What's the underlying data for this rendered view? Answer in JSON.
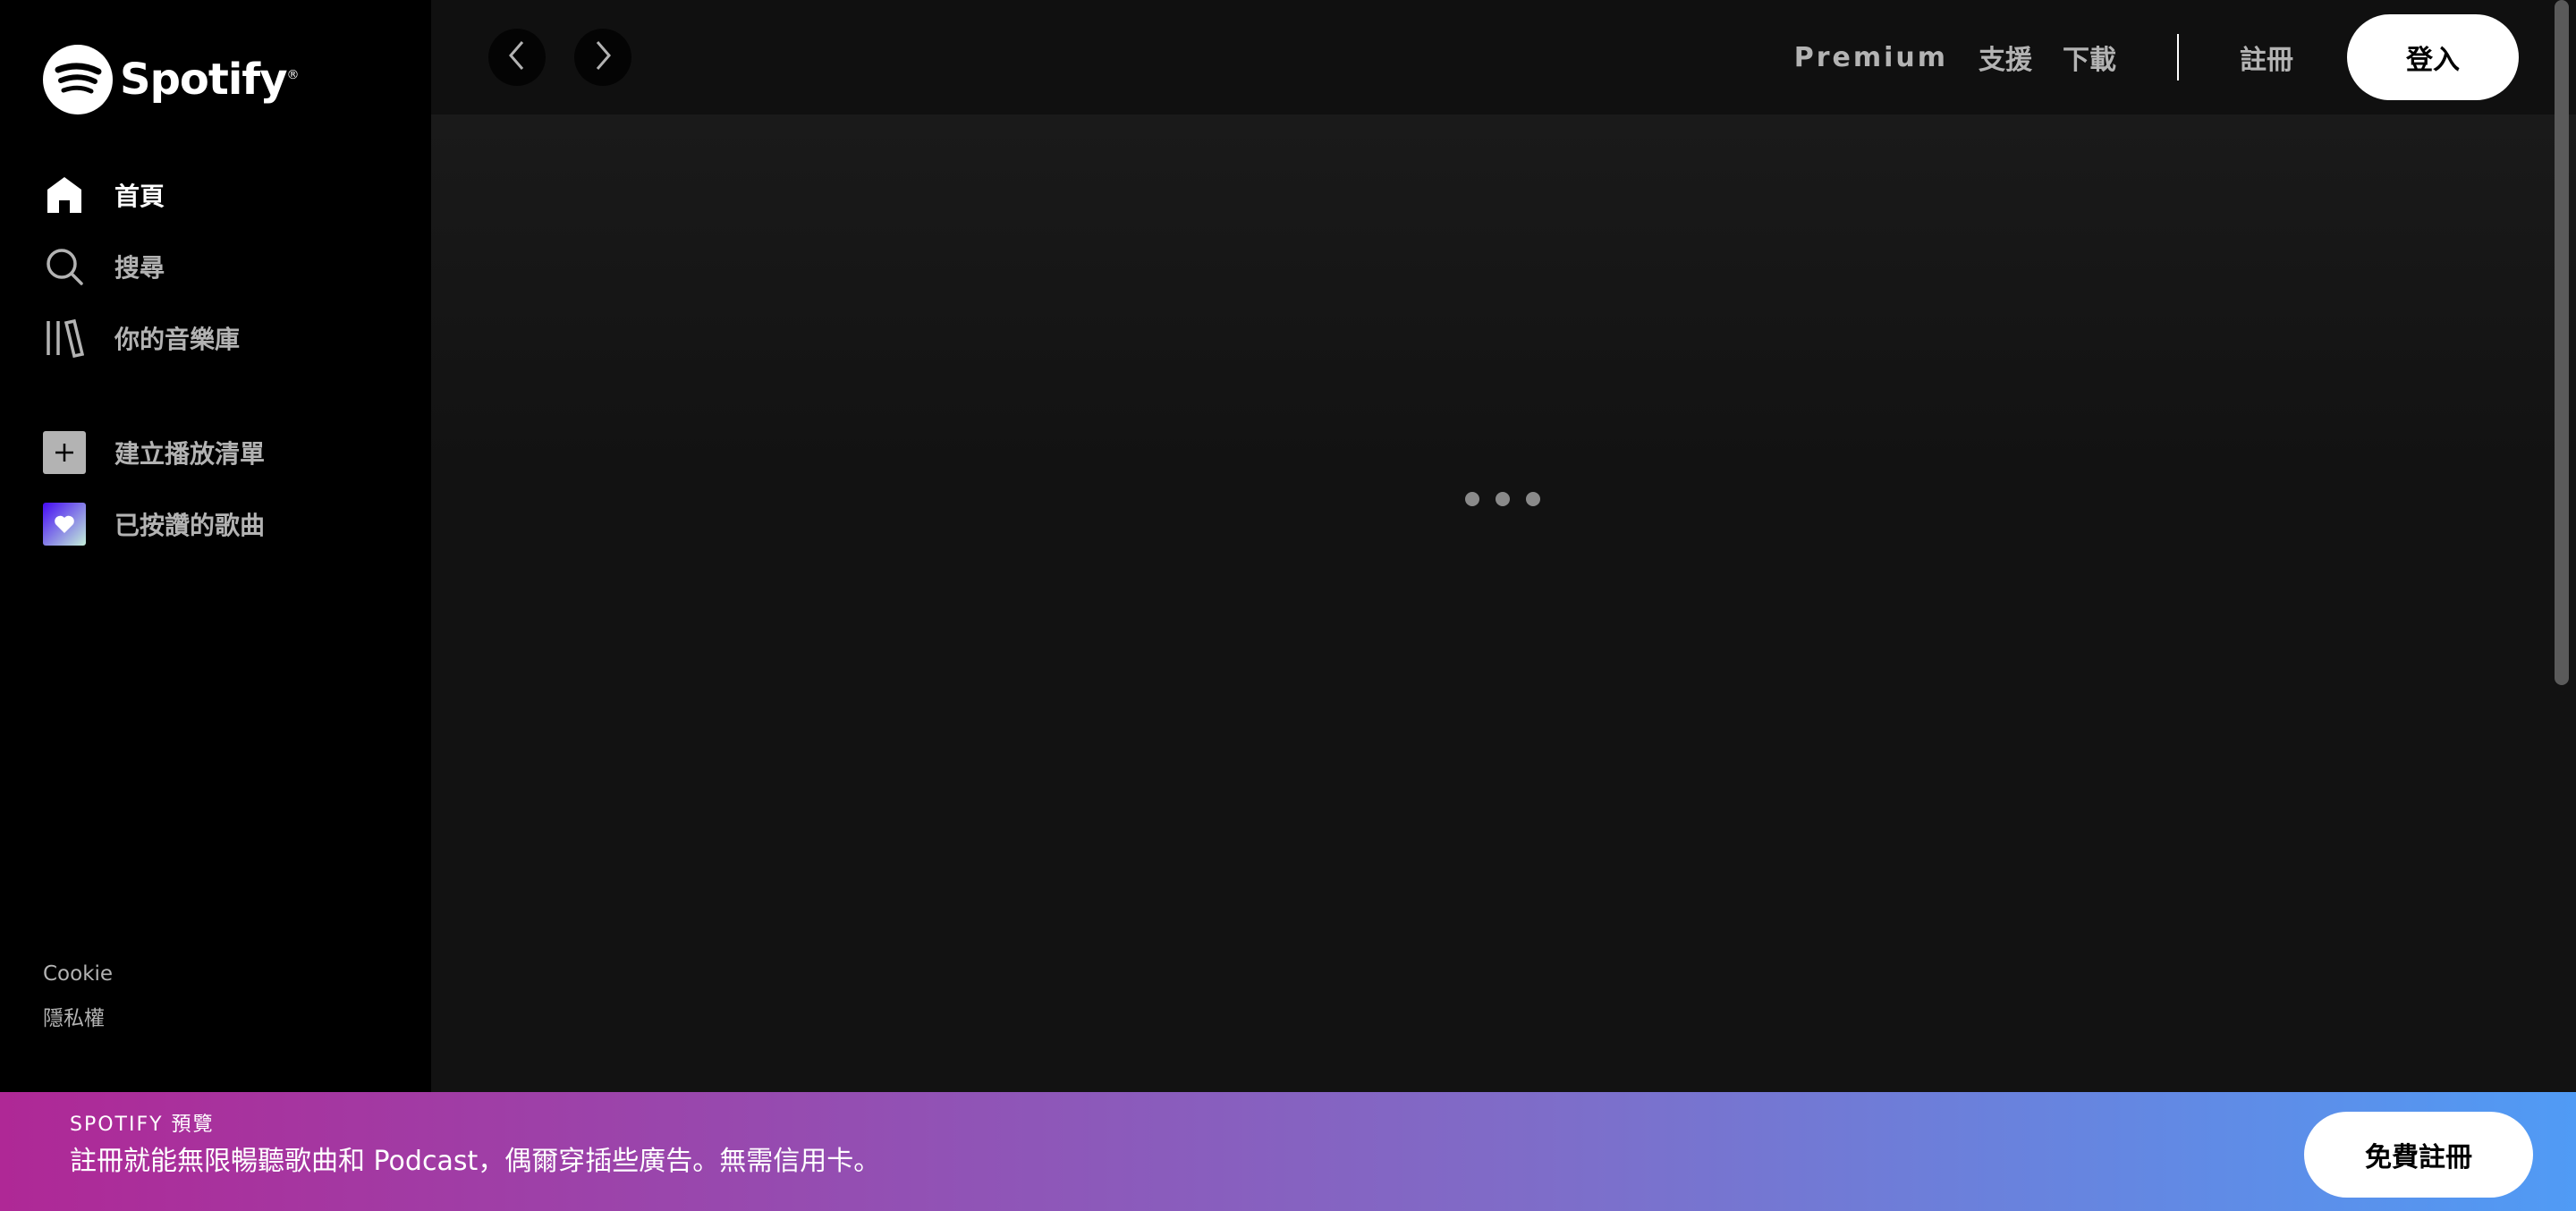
{
  "app": {
    "brand_name": "Spotify",
    "accent_color": "#1db954"
  },
  "sidebar": {
    "nav": [
      {
        "label": "首頁",
        "icon": "home-icon"
      },
      {
        "label": "搜尋",
        "icon": "search-icon"
      },
      {
        "label": "你的音樂庫",
        "icon": "library-icon"
      }
    ],
    "actions": [
      {
        "label": "建立播放清單",
        "icon": "plus-icon"
      },
      {
        "label": "已按讚的歌曲",
        "icon": "heart-icon"
      }
    ],
    "footer": {
      "cookie": "Cookie",
      "privacy": "隱私權"
    }
  },
  "topbar": {
    "premium": "Premium",
    "support": "支援",
    "download": "下載",
    "signup": "註冊",
    "login": "登入"
  },
  "banner": {
    "title": "SPOTIFY 預覽",
    "description": "註冊就能無限暢聽歌曲和 Podcast，偶爾穿插些廣告。無需信用卡。",
    "button": "免費註冊",
    "gradient_start": "#af2896",
    "gradient_end": "#509bf5"
  }
}
